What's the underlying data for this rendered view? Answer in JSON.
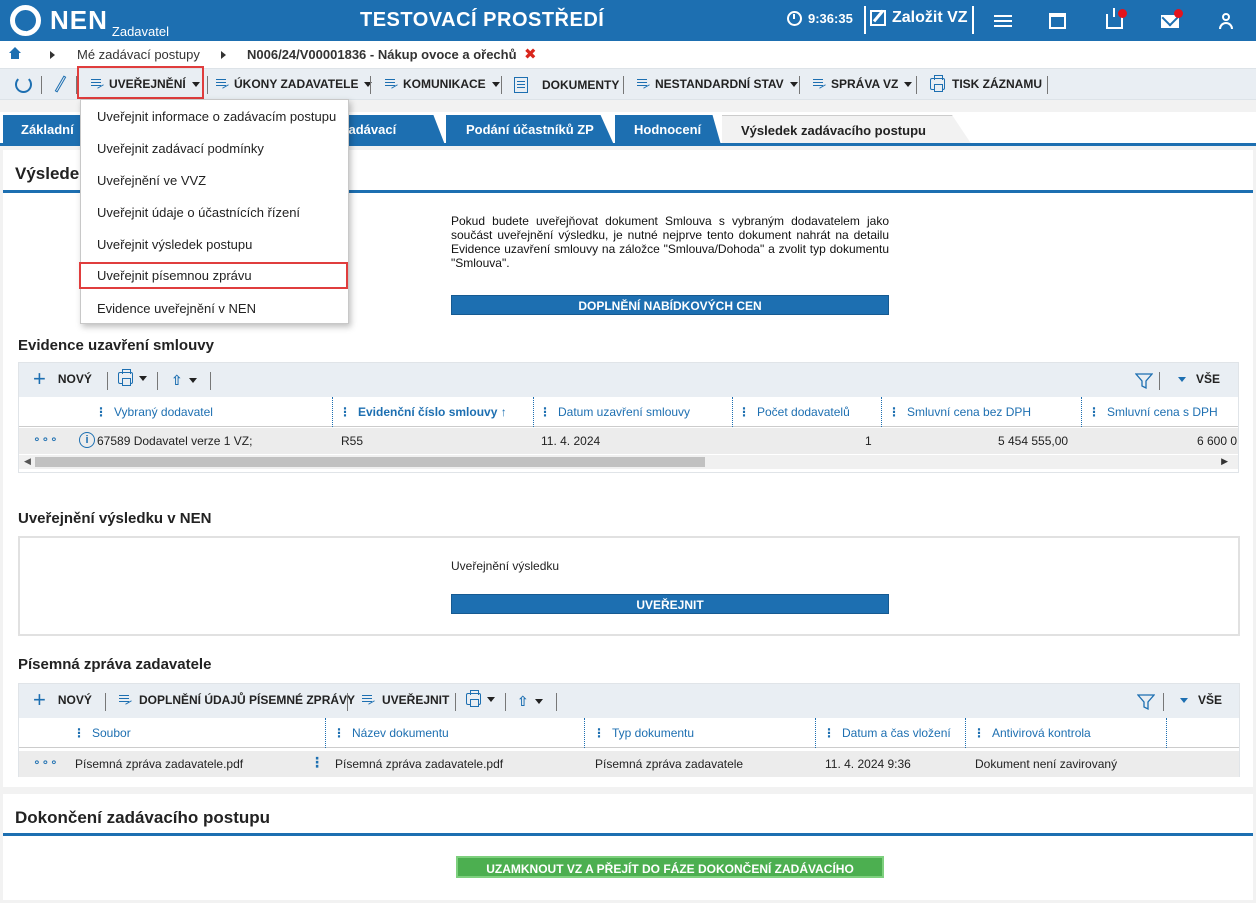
{
  "header": {
    "logo_text": "NEN",
    "logo_sub": "Zadavatel",
    "env_title": "TESTOVACÍ PROSTŘEDÍ",
    "time": "9:36:35",
    "new_vz_label": "Založit VZ"
  },
  "breadcrumb": {
    "item1": "Mé zadávací postupy",
    "item2": "N006/24/V00001836 - Nákup ovoce a ořechů",
    "close": "✖"
  },
  "toolbar": {
    "uverejneni": "UVEŘEJNĚNÍ",
    "ukony": "ÚKONY ZADAVATELE",
    "komunikace": "KOMUNIKACE",
    "dokumenty": "DOKUMENTY",
    "nestandardni": "NESTANDARDNÍ STAV",
    "sprava": "SPRÁVA VZ",
    "tisk": "TISK ZÁZNAMU"
  },
  "dropdown": {
    "items": [
      "Uveřejnit informace o zadávacím postupu",
      "Uveřejnit zadávací podmínky",
      "Uveřejnění ve VVZ",
      "Uveřejnit údaje o účastnících řízení",
      "Uveřejnit výsledek postupu",
      "Uveřejnit písemnou zprávu",
      "Evidence uveřejnění v NEN"
    ]
  },
  "tabs": {
    "t1": "Základní",
    "t2": "zadávací podmínky",
    "t3": "Podání účastníků ZP",
    "t4": "Hodnocení",
    "t5": "Výsledek zadávacího postupu"
  },
  "result": {
    "title": "Výsledek zadávacího postupu",
    "note": "Pokud budete uveřejňovat dokument Smlouva s vybraným dodavatelem jako součást uveřejnění výsledku, je nutné nejprve tento dokument nahrát na detailu Evidence uzavření smlouvy na záložce \"Smlouva/Dohoda\" a zvolit typ dokumentu \"Smlouva\".",
    "btn_prices": "DOPLNĚNÍ NABÍDKOVÝCH CEN"
  },
  "contracts": {
    "title": "Evidence uzavření smlouvy",
    "new_label": "NOVÝ",
    "all_label": "VŠE",
    "columns": [
      "Vybraný dodavatel",
      "Evidenční číslo smlouvy",
      "Datum uzavření smlouvy",
      "Počet dodavatelů",
      "Smluvní cena bez DPH",
      "Smluvní cena s DPH"
    ],
    "rows": [
      {
        "supplier": "67589 Dodavatel verze 1 VZ;",
        "number": "R55",
        "date": "11. 4. 2024",
        "count": "1",
        "price_no_vat": "5 454 555,00",
        "price_vat": "6 600 0"
      }
    ]
  },
  "publication": {
    "title": "Uveřejnění výsledku v NEN",
    "label": "Uveřejnění výsledku",
    "btn": "UVEŘEJNIT"
  },
  "report": {
    "title": "Písemná zpráva zadavatele",
    "new_label": "NOVÝ",
    "fill_label": "DOPLNĚNÍ ÚDAJŮ PÍSEMNÉ ZPRÁVY",
    "publish_label": "UVEŘEJNIT",
    "all_label": "VŠE",
    "columns": [
      "Soubor",
      "Název dokumentu",
      "Typ dokumentu",
      "Datum a čas vložení",
      "Antivirová kontrola"
    ],
    "rows": [
      {
        "file": "Písemná zpráva zadavatele.pdf",
        "name": "Písemná zpráva zadavatele.pdf",
        "type": "Písemná zpráva zadavatele",
        "datetime": "11. 4. 2024 9:36",
        "antivirus": "Dokument není zavirovaný"
      }
    ]
  },
  "finish": {
    "title": "Dokončení zadávacího postupu",
    "btn": "UZAMKNOUT VZ A PŘEJÍT DO FÁZE DOKONČENÍ ZADÁVACÍHO POSTUPU"
  },
  "colors": {
    "primary": "#1d6fb1",
    "highlight": "#e03d3d",
    "green": "#4caf50",
    "notification": "#e3131c"
  }
}
